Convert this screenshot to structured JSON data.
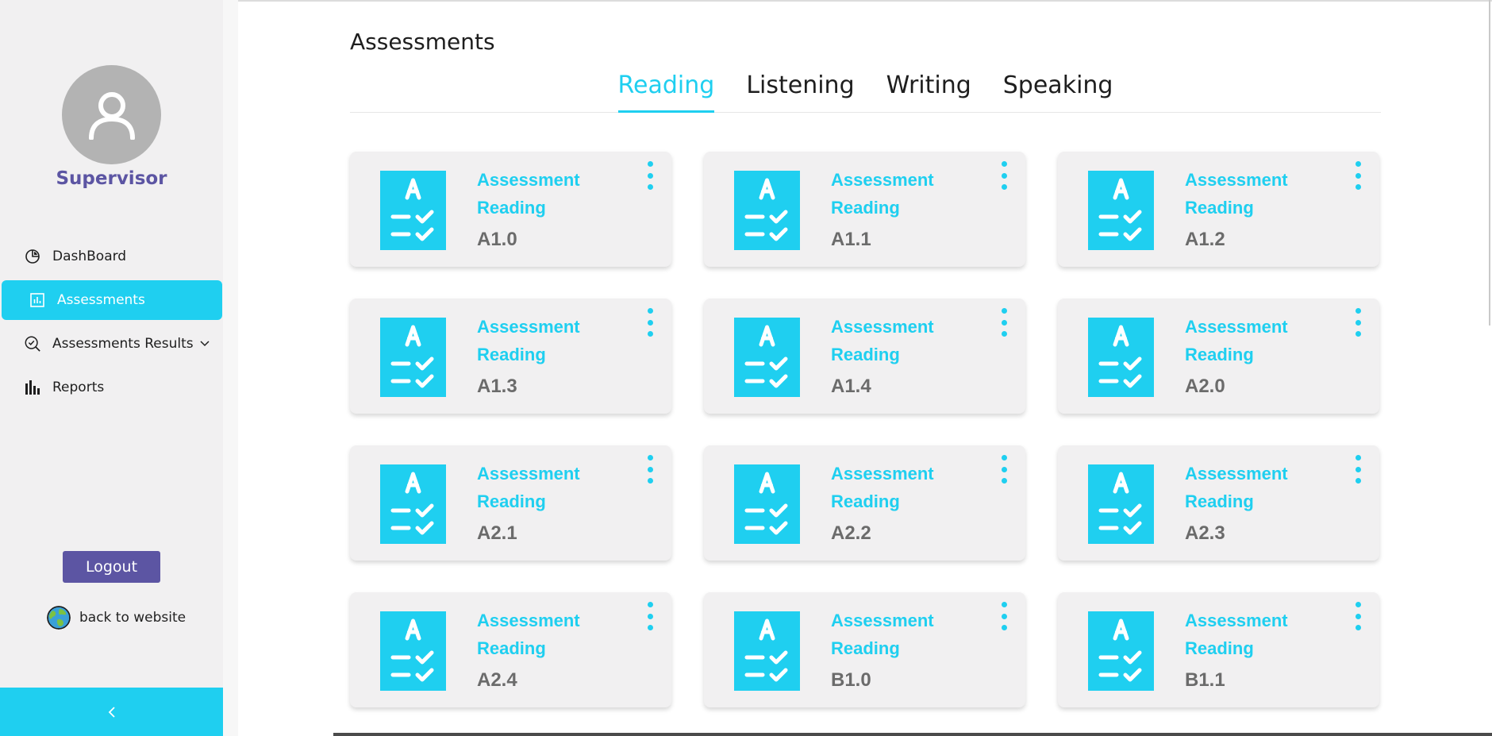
{
  "sidebar": {
    "user": {
      "name": "Supervisor"
    },
    "nav": [
      {
        "label": "DashBoard",
        "icon": "pie-chart-icon",
        "active": false
      },
      {
        "label": "Assessments",
        "icon": "bar-chart-box-icon",
        "active": true
      },
      {
        "label": "Assessments Results",
        "icon": "search-check-icon",
        "active": false,
        "has_dropdown": true
      },
      {
        "label": "Reports",
        "icon": "bar-graph-icon",
        "active": false
      }
    ],
    "logout_label": "Logout",
    "back_label": "back to website",
    "collapse_icon": "chevron-left-icon"
  },
  "main": {
    "title": "Assessments",
    "tabs": [
      {
        "label": "Reading",
        "active": true
      },
      {
        "label": "Listening",
        "active": false
      },
      {
        "label": "Writing",
        "active": false
      },
      {
        "label": "Speaking",
        "active": false
      }
    ],
    "cards": [
      {
        "title": "Assessment Reading",
        "level": "A1.0"
      },
      {
        "title": "Assessment Reading",
        "level": "A1.1"
      },
      {
        "title": "Assessment Reading",
        "level": "A1.2"
      },
      {
        "title": "Assessment Reading",
        "level": "A1.3"
      },
      {
        "title": "Assessment Reading",
        "level": "A1.4"
      },
      {
        "title": "Assessment Reading",
        "level": "A2.0"
      },
      {
        "title": "Assessment Reading",
        "level": "A2.1"
      },
      {
        "title": "Assessment Reading",
        "level": "A2.2"
      },
      {
        "title": "Assessment Reading",
        "level": "A2.3"
      },
      {
        "title": "Assessment Reading",
        "level": "A2.4"
      },
      {
        "title": "Assessment Reading",
        "level": "B1.0"
      },
      {
        "title": "Assessment Reading",
        "level": "B1.1"
      }
    ]
  },
  "colors": {
    "accent": "#1fcff0",
    "brand": "#5c55a3",
    "sidebar_bg": "#f1f0f1",
    "card_bg": "#f1f0f1",
    "level_text": "#6b6b6b"
  }
}
